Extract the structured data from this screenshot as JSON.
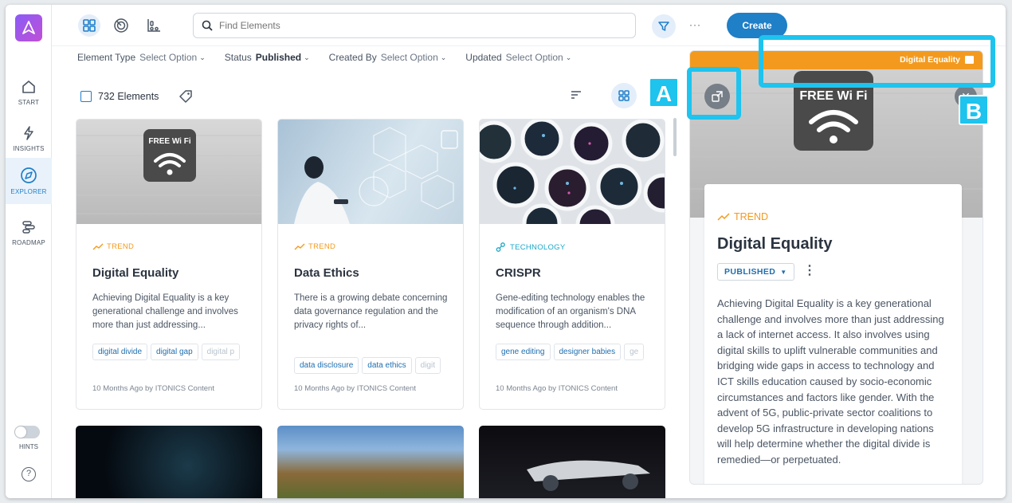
{
  "sidebar": {
    "logo": "A",
    "items": [
      {
        "label": "START",
        "icon": "home-icon"
      },
      {
        "label": "INSIGHTS",
        "icon": "bolt-icon"
      },
      {
        "label": "EXPLORER",
        "icon": "compass-icon"
      },
      {
        "label": "ROADMAP",
        "icon": "roadmap-icon"
      }
    ],
    "hints_label": "HINTS",
    "help_label": "?"
  },
  "topbar": {
    "search_placeholder": "Find Elements",
    "more_label": "···",
    "create_label": "Create"
  },
  "filters": [
    {
      "label": "Element Type",
      "value": "Select Option"
    },
    {
      "label": "Status",
      "value": "Published"
    },
    {
      "label": "Created By",
      "value": "Select Option"
    },
    {
      "label": "Updated",
      "value": "Select Option"
    }
  ],
  "list": {
    "count_label": "732 Elements"
  },
  "cards": [
    {
      "type": "TREND",
      "title": "Digital Equality",
      "description": "Achieving Digital Equality is a key generational challenge and involves more than just addressing...",
      "tags": [
        "digital divide",
        "digital gap",
        "digital p"
      ],
      "footer": "10 Months Ago by ITONICS Content"
    },
    {
      "type": "TREND",
      "title": "Data Ethics",
      "description": "There is a growing debate concerning data governance regulation and the privacy rights of...",
      "tags": [
        "data disclosure",
        "data ethics",
        "digit"
      ],
      "footer": "10 Months Ago by ITONICS Content"
    },
    {
      "type": "TECHNOLOGY",
      "title": "CRISPR",
      "description": "Gene-editing technology enables the modification of an organism's DNA sequence through addition...",
      "tags": [
        "gene editing",
        "designer babies",
        "ge"
      ],
      "footer": "10 Months Ago by ITONICS Content"
    }
  ],
  "image_text": {
    "wifi_sign": "FREE Wi Fi"
  },
  "detail": {
    "header_title": "Digital Equality",
    "type": "TREND",
    "title": "Digital Equality",
    "status": "PUBLISHED",
    "description": "Achieving Digital Equality is a key generational challenge and involves more than just addressing a lack of internet access. It also involves using digital skills to uplift vulnerable communities and bridging wide gaps in access to technology and ICT skills education caused by socio-economic circumstances and factors like gender. With the advent of 5G, public-private sector coalitions to develop 5G infrastructure in developing nations will help determine whether the digital divide is remedied—or perpetuated."
  },
  "annotations": {
    "a": "A",
    "b": "B"
  },
  "colors": {
    "accent": "#1f7fc7",
    "trend": "#f39a1e",
    "technology": "#1aa7c9",
    "callout": "#1ec3ee"
  }
}
